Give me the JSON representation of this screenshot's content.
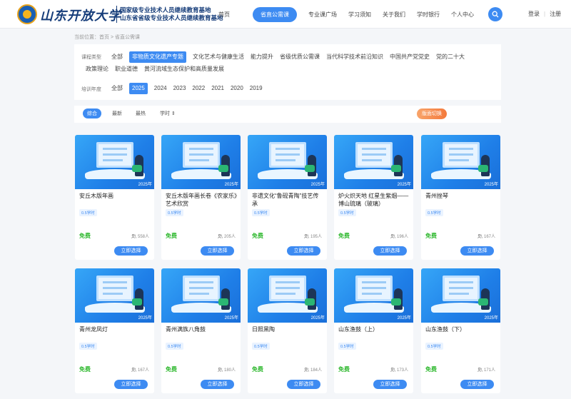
{
  "header": {
    "logo_text": "山东开放大学",
    "tagline_1": "国家级专业技术人员继续教育基地",
    "tagline_2": "山东省省级专业技术人员继续教育基地",
    "nav": [
      "首页",
      "省直公需课",
      "专业课广场",
      "学习须知",
      "关于我们",
      "学时银行",
      "个人中心"
    ],
    "active_nav": 1,
    "login": "登录",
    "register": "注册"
  },
  "breadcrumb": "当前位置：首页 > 省直公需课",
  "filters": {
    "type_label": "课程类型",
    "types": [
      "全部",
      "非物质文化遗产专题",
      "文化艺术与健康生活",
      "能力提升",
      "省级优质公需课",
      "当代科学技术前沿知识",
      "中国共产党党史",
      "党的二十大",
      "政策理论",
      "职业道德",
      "黄河流域生态保护和高质量发展"
    ],
    "active_type": 1,
    "year_label": "培训年度",
    "years": [
      "全部",
      "2025",
      "2024",
      "2023",
      "2022",
      "2021",
      "2020",
      "2019"
    ],
    "active_year": 1
  },
  "sort": {
    "options": [
      "综合",
      "最新",
      "最热",
      "学时 ⇕"
    ],
    "active": 0,
    "switch_label": "版面切换"
  },
  "cards": [
    {
      "title": "安丘木版年画",
      "hours": "0.5学时",
      "price": "免费",
      "count": "558人",
      "button": "立即选择",
      "year": "2025年"
    },
    {
      "title": "安丘木版年画长卷《农家乐》艺术欣赏",
      "hours": "0.5学时",
      "price": "免费",
      "count": "205人",
      "button": "立即选择",
      "year": "2025年"
    },
    {
      "title": "非遗文化“鲁砚青陶”技艺传承",
      "hours": "0.5学时",
      "price": "免费",
      "count": "195人",
      "button": "立即选择",
      "year": "2025年"
    },
    {
      "title": "炉火炽天地 红星生紫烟——博山琉璃（玻璃）",
      "hours": "0.5学时",
      "price": "免费",
      "count": "196人",
      "button": "立即选择",
      "year": "2025年"
    },
    {
      "title": "青州挫琴",
      "hours": "0.5学时",
      "price": "免费",
      "count": "167人",
      "button": "立即选择",
      "year": "2025年"
    },
    {
      "title": "青州龙凤灯",
      "hours": "0.5学时",
      "price": "免费",
      "count": "167人",
      "button": "立即选择",
      "year": "2025年"
    },
    {
      "title": "青州满族八角鼓",
      "hours": "0.5学时",
      "price": "免费",
      "count": "180人",
      "button": "立即选择",
      "year": "2025年"
    },
    {
      "title": "日照黑陶",
      "hours": "0.5学时",
      "price": "免费",
      "count": "184人",
      "button": "立即选择",
      "year": "2025年"
    },
    {
      "title": "山东渔鼓（上）",
      "hours": "0.5学时",
      "price": "免费",
      "count": "173人",
      "button": "立即选择",
      "year": "2025年"
    },
    {
      "title": "山东渔鼓（下）",
      "hours": "0.5学时",
      "price": "免费",
      "count": "171人",
      "button": "立即选择",
      "year": "2025年"
    }
  ]
}
